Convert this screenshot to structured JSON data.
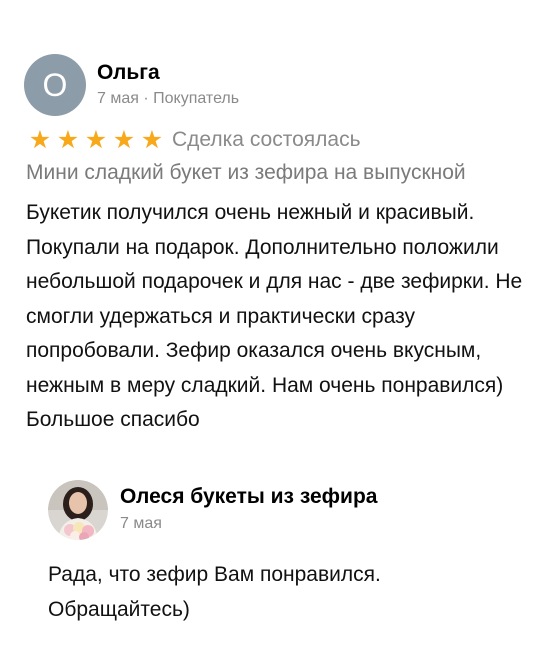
{
  "review": {
    "avatar_letter": "О",
    "author": "Ольга",
    "meta": "7 мая · Покупатель",
    "rating": 5,
    "rating_max": 5,
    "deal_status": "Сделка состоялась",
    "product": "Мини сладкий букет из зефира на выпускной",
    "text": "Букетик получился очень нежный и красивый. Покупали на подарок. Дополнительно положили небольшой подарочек и для нас - две зефирки. Не смогли удержаться и практически сразу попробовали. Зефир оказался очень вкусным, нежным в меру сладкий. Нам очень понравился) Большое спасибо"
  },
  "reply": {
    "author": "Олеся букеты из зефира",
    "date": "7 мая",
    "text": "Рада, что зефир Вам понравился. Обращайтесь)"
  },
  "colors": {
    "avatar_bg": "#8c9ca9",
    "star": "#f7a81b",
    "muted_text": "#8a8a8a"
  },
  "icons": {
    "star": "star-icon"
  }
}
